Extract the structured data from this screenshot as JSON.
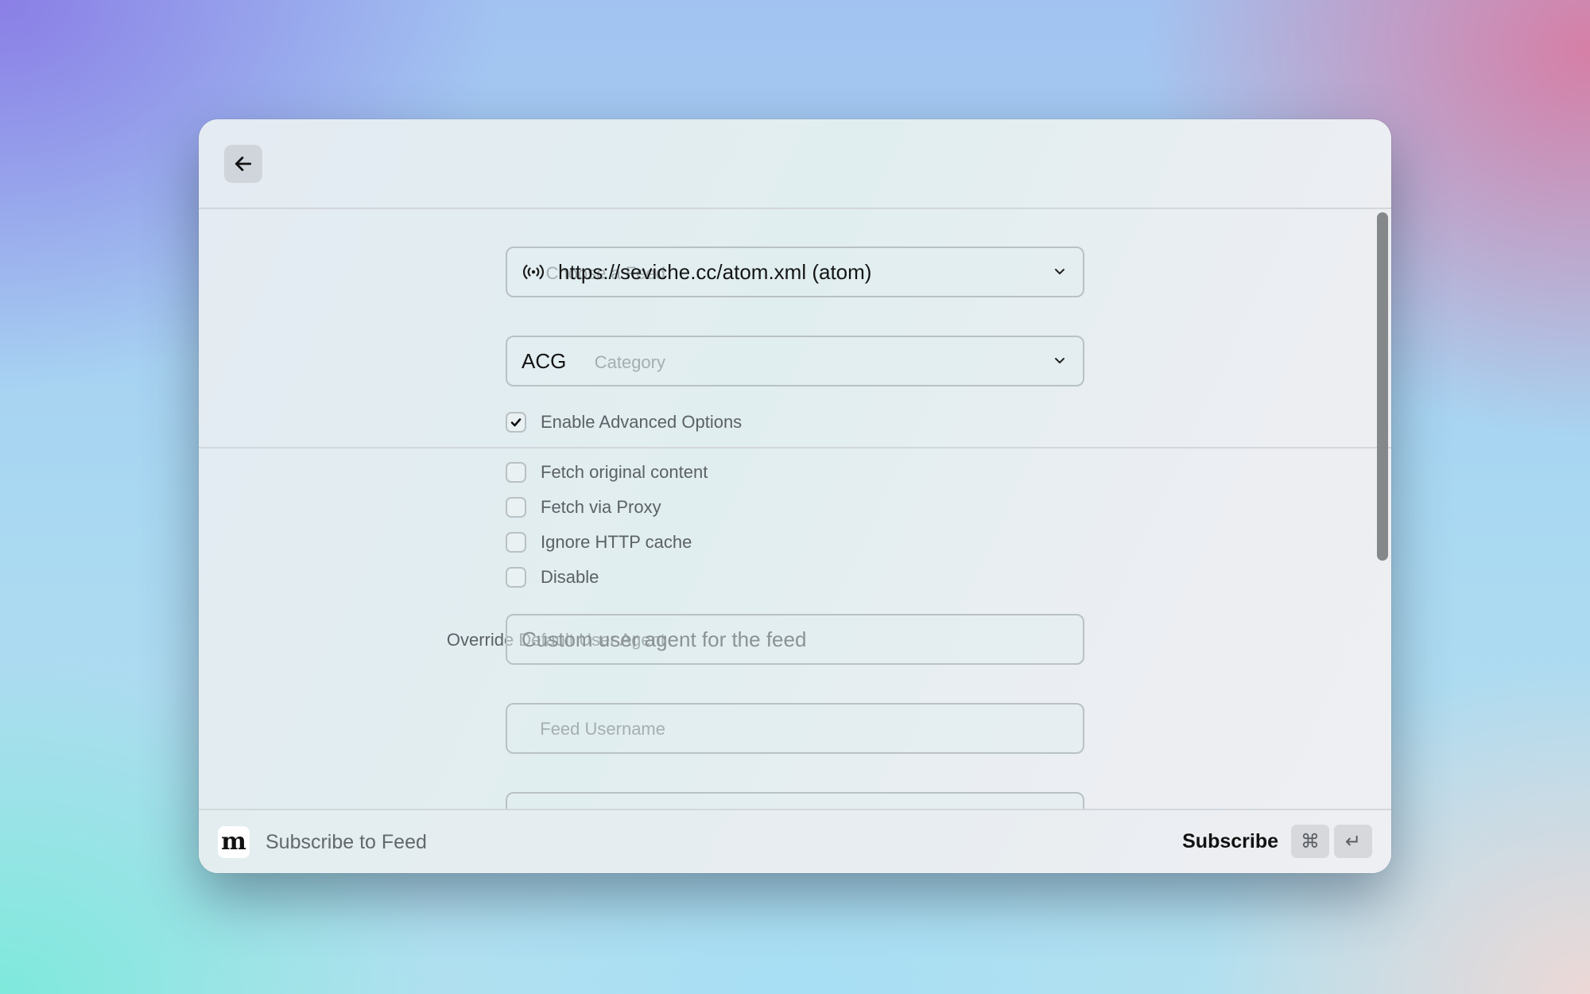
{
  "window": {
    "back_button_label": "Back"
  },
  "form": {
    "feed": {
      "label": "Choose a Feed",
      "value": "https://seviche.cc/atom.xml (atom)",
      "icon": "rss-broadcast-icon"
    },
    "category": {
      "label": "Category",
      "value": "ACG"
    },
    "advanced": {
      "label": "Enable Advanced Options",
      "checked": true
    },
    "options": [
      {
        "label": "Fetch original content",
        "checked": false
      },
      {
        "label": "Fetch via Proxy",
        "checked": false
      },
      {
        "label": "Ignore HTTP cache",
        "checked": false
      },
      {
        "label": "Disable",
        "checked": false
      }
    ],
    "user_agent": {
      "label": "Override Default User Agent",
      "value": "",
      "placeholder": "Custom user agent for the feed"
    },
    "username": {
      "label": "Feed Username",
      "value": "",
      "placeholder": ""
    }
  },
  "footer": {
    "app_logo": "m",
    "title": "Subscribe to Feed",
    "subscribe_label": "Subscribe",
    "shortcut_cmd": "⌘",
    "shortcut_enter": "↵"
  },
  "colors": {
    "label_text": "#5b6166",
    "primary_text": "#141414",
    "scrollbar": "#85888b",
    "border": "#b9c1c4"
  }
}
